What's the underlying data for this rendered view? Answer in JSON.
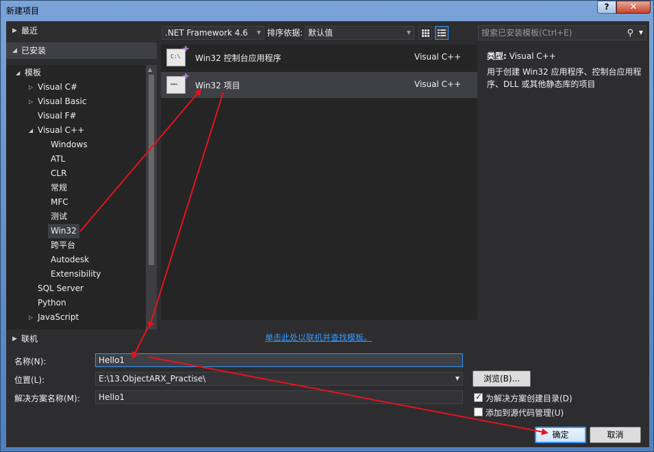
{
  "window": {
    "title": "新建项目",
    "help_label": "?",
    "close_label": "✕"
  },
  "left": {
    "recent": "最近",
    "installed": "已安装",
    "online": "联机",
    "tree": [
      {
        "label": "模板"
      },
      {
        "label": "Visual C#"
      },
      {
        "label": "Visual Basic"
      },
      {
        "label": "Visual F#"
      },
      {
        "label": "Visual C++"
      },
      {
        "label": "Windows"
      },
      {
        "label": "ATL"
      },
      {
        "label": "CLR"
      },
      {
        "label": "常规"
      },
      {
        "label": "MFC"
      },
      {
        "label": "测试"
      },
      {
        "label": "Win32"
      },
      {
        "label": "跨平台"
      },
      {
        "label": "Autodesk"
      },
      {
        "label": "Extensibility"
      },
      {
        "label": "SQL Server"
      },
      {
        "label": "Python"
      },
      {
        "label": "JavaScript"
      }
    ]
  },
  "toolbar": {
    "framework": ".NET Framework 4.6",
    "sort_label": "排序依据:",
    "sort_value": "默认值"
  },
  "search": {
    "placeholder": "搜索已安装模板(Ctrl+E)"
  },
  "templates": [
    {
      "name": "Win32 控制台应用程序",
      "lang": "Visual C++",
      "icon_glyph": "C:\\"
    },
    {
      "name": "Win32 项目",
      "lang": "Visual C++",
      "icon_glyph": "▭▭"
    }
  ],
  "online_link": "单击此处以联机并查找模板。",
  "description": {
    "type_label": "类型:",
    "type_value": "Visual C++",
    "text": "用于创建 Win32 应用程序、控制台应用程序、DLL 或其他静态库的项目"
  },
  "form": {
    "name_label": "名称(N):",
    "name_value": "Hello1",
    "location_label": "位置(L):",
    "location_value": "E:\\13.ObjectARX_Practise\\",
    "solution_label": "解决方案名称(M):",
    "solution_value": "Hello1",
    "browse_label": "浏览(B)...",
    "create_dir_label": "为解决方案创建目录(D)",
    "create_dir_checked": true,
    "source_control_label": "添加到源代码管理(U)",
    "source_control_checked": false,
    "ok_label": "确定",
    "cancel_label": "取消"
  },
  "colors": {
    "accent": "#3399ff",
    "annotation_arrow": "#e8131b",
    "panel_bg": "#2d2d30"
  }
}
